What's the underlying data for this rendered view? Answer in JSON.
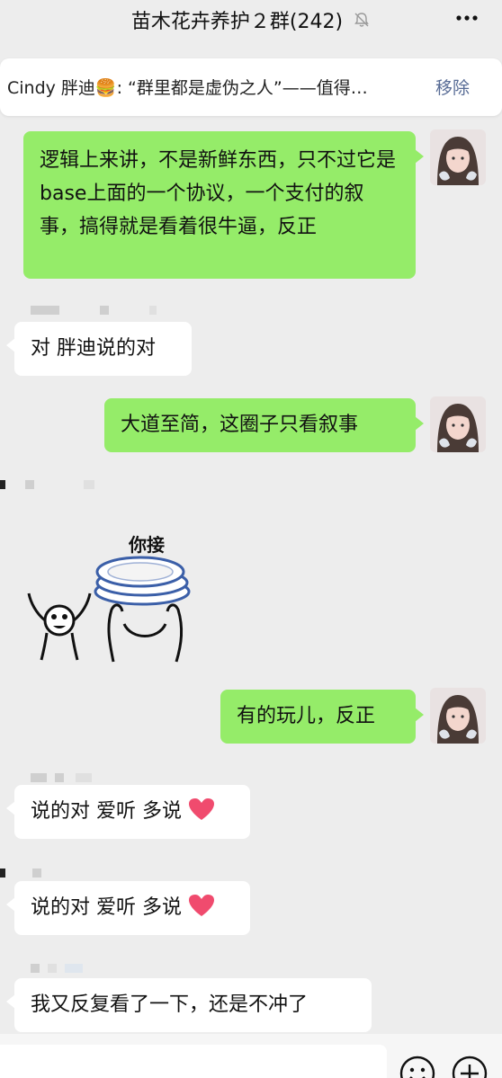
{
  "header": {
    "title": "苗木花卉养护２群(242)",
    "mute_icon": "bell-off-icon",
    "more_icon": "more-icon"
  },
  "pinned": {
    "text": "Cindy 胖迪🍔: “群里都是虚伪之人”——值得…",
    "action": "移除"
  },
  "messages": [
    {
      "side": "mine",
      "text": "逻辑上来讲，不是新鲜东西，只不过它是base上面的一个协议，一个支付的叙事，搞得就是看着很牛逼，反正"
    },
    {
      "side": "theirs",
      "text": "对 胖迪说的对"
    },
    {
      "side": "mine",
      "text": "大道至简，这圈子只看叙事"
    },
    {
      "side": "theirs",
      "type": "sticker",
      "caption": "你接"
    },
    {
      "side": "mine",
      "text": "有的玩儿，反正"
    },
    {
      "side": "theirs",
      "text": "说的对 爱听 多说"
    },
    {
      "side": "theirs",
      "text": "说的对 爱听 多说"
    },
    {
      "side": "theirs",
      "text": "我又反复看了一下，还是不冲了"
    }
  ],
  "toolbar": {
    "emoji_icon": "emoji-icon",
    "plus_icon": "plus-icon"
  },
  "colors": {
    "bubble_mine": "#95ec69",
    "bubble_theirs": "#ffffff",
    "background": "#ededed",
    "link": "#576b95"
  }
}
